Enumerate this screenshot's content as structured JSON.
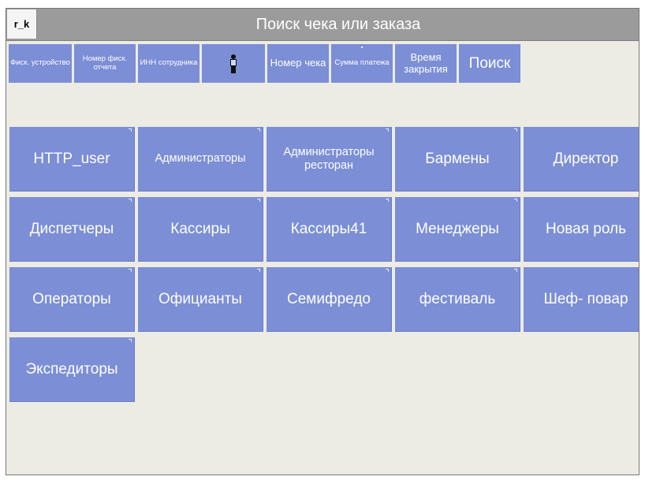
{
  "header": {
    "user": "r_k",
    "title": "Поиск чека или заказа"
  },
  "filters": [
    {
      "label": "Фиск. устройство"
    },
    {
      "label": "Номер фиск. отчета"
    },
    {
      "label": "ИНН сотрудника"
    },
    {
      "icon": "person-icon"
    },
    {
      "label": "Номер чека"
    },
    {
      "label": "Сумма платежа"
    },
    {
      "label": "Время закрытия"
    },
    {
      "label": "Поиск"
    }
  ],
  "roles": [
    "HTTP_user",
    "Администраторы",
    "Администраторы ресторан",
    "Бармены",
    "Директор",
    "Диспетчеры",
    "Кассиры",
    "Кассиры41",
    "Менеджеры",
    "Новая роль",
    "Операторы",
    "Официанты",
    "Семифредо",
    "фестиваль",
    "Шеф- повар",
    "Экспедиторы"
  ],
  "colors": {
    "tile": "#7b8ed6",
    "titlebar": "#9b9b9b",
    "background": "#ecebe4"
  }
}
